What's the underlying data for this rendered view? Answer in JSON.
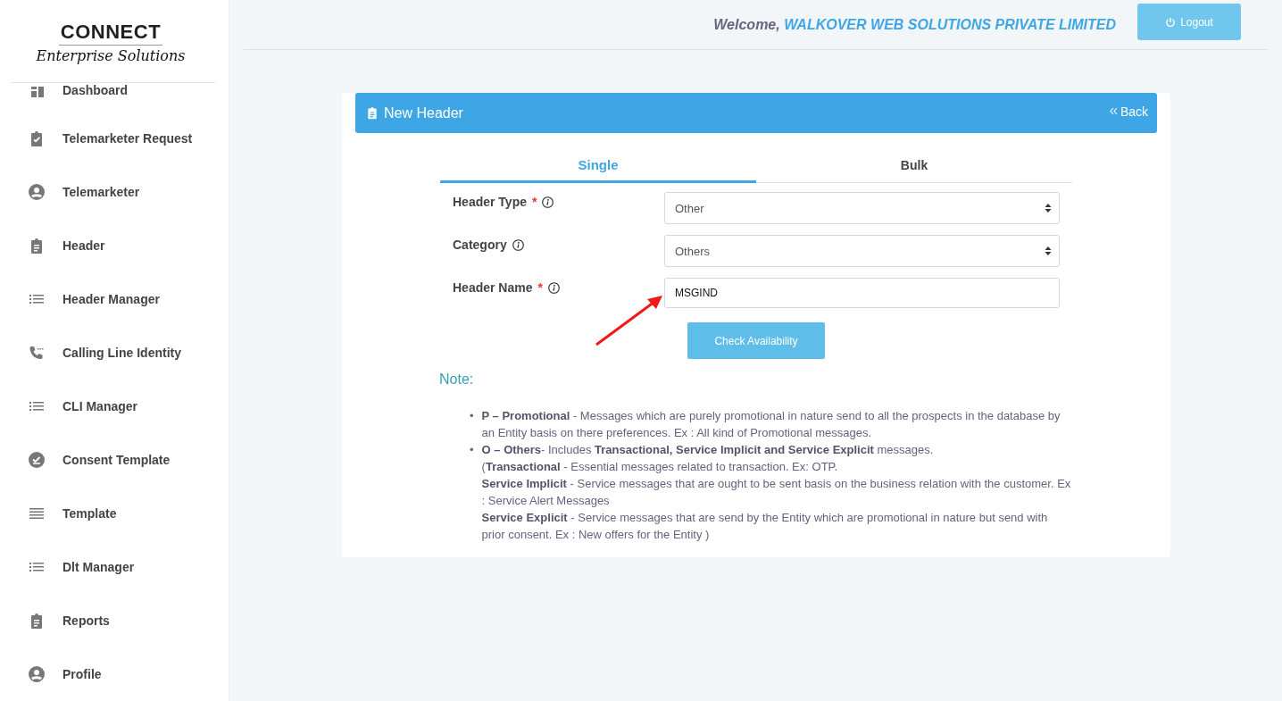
{
  "logo": {
    "name": "CONNECT",
    "tagline": "Enterprise Solutions"
  },
  "sidebar": {
    "items": [
      {
        "label": "Dashboard",
        "selected": false
      },
      {
        "label": "Telemarketer Request",
        "selected": false
      },
      {
        "label": "Telemarketer",
        "selected": false
      },
      {
        "label": "Header",
        "selected": false
      },
      {
        "label": "Header Manager",
        "selected": false
      },
      {
        "label": "Calling Line Identity",
        "selected": false
      },
      {
        "label": "CLI Manager",
        "selected": false
      },
      {
        "label": "Consent Template",
        "selected": false
      },
      {
        "label": "Template",
        "selected": false
      },
      {
        "label": "Dlt Manager",
        "selected": false
      },
      {
        "label": "Reports",
        "selected": false
      },
      {
        "label": "Profile",
        "selected": false
      }
    ]
  },
  "topbar": {
    "welcome": "Welcome,",
    "company": "WALKOVER WEB SOLUTIONS PRIVATE LIMITED",
    "logout": "Logout"
  },
  "card": {
    "title": "New Header",
    "back": "Back",
    "tabs": [
      {
        "label": "Single",
        "selected": true
      },
      {
        "label": "Bulk",
        "selected": false
      }
    ],
    "fields": [
      {
        "label": "Header Type",
        "mark": "*",
        "kind": "select",
        "value": "Other"
      },
      {
        "label": "Category",
        "kind": "select",
        "value": "Others"
      },
      {
        "label": "Header Name",
        "mark": "*",
        "kind": "text",
        "value": "MSGIND"
      }
    ],
    "button": "Check Availability",
    "note_title": "Note:",
    "notes": [
      {
        "marker": "•",
        "lines": [
          "**P – Promotional** - Messages which are purely promotional in nature send to all the prospects in the database by an Entity basis on there preferences. Ex : All kind of Promotional messages."
        ]
      },
      {
        "marker": "•",
        "lines": [
          "**O – Others**- Includes **Transactional, Service Implicit and Service Explicit** messages.",
          "(**Transactional** - Essential messages related to transaction. Ex: OTP.",
          "**Service Implicit** - Service messages that are ought to be sent basis on the business relation with the customer. Ex : Service Alert Messages",
          "**Service Explicit** - Service messages that are send by the Entity which are promotional in nature but send with prior consent. Ex : New offers for the Entity )"
        ]
      }
    ]
  }
}
